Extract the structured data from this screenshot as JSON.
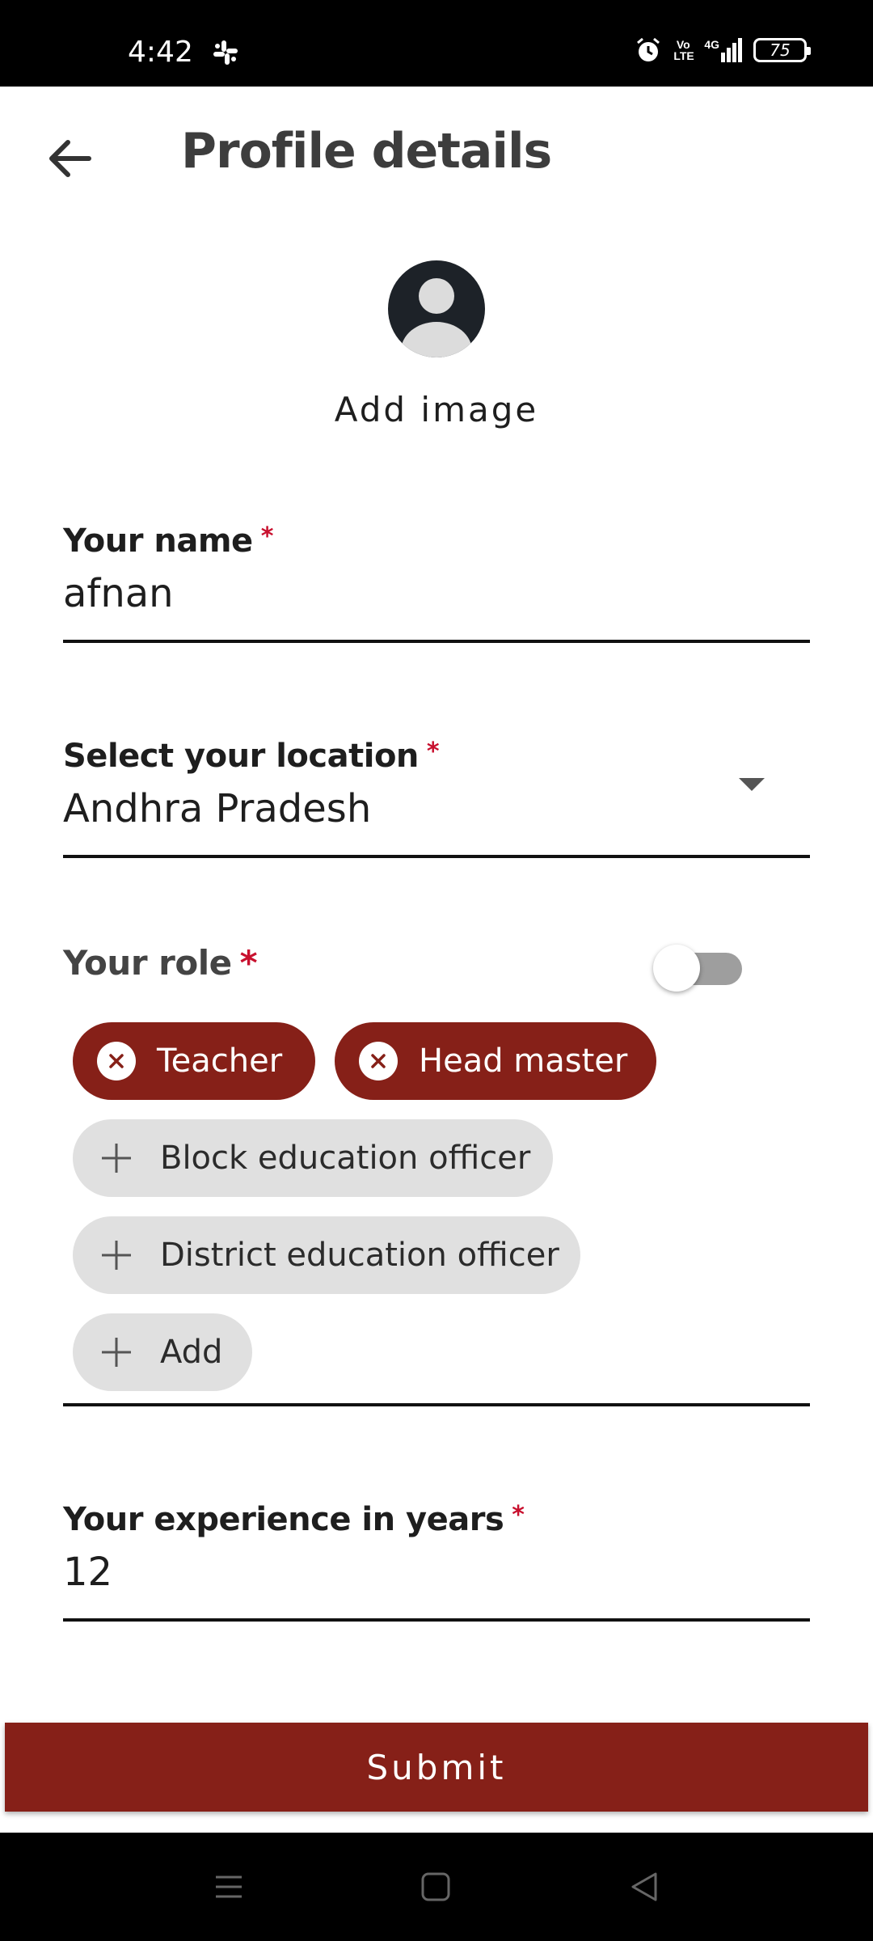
{
  "status_bar": {
    "time": "4:42",
    "volte_label": "Vo\nLTE",
    "network_label": "4G",
    "battery_level": "75"
  },
  "header": {
    "title": "Profile details"
  },
  "avatar": {
    "add_image_label": "Add image"
  },
  "form": {
    "name": {
      "label": "Your name",
      "required_mark": "*",
      "value": "afnan"
    },
    "location": {
      "label": "Select your location",
      "required_mark": "*",
      "value": "Andhra Pradesh"
    },
    "role": {
      "label": "Your role",
      "required_mark": "*",
      "toggle_on": false,
      "selected_chips": [
        "Teacher",
        "Head master"
      ],
      "available_chips": [
        "Block education officer",
        "District education officer"
      ],
      "add_label": "Add"
    },
    "experience": {
      "label": "Your experience in years",
      "required_mark": "*",
      "value": "12"
    }
  },
  "submit_label": "Submit",
  "colors": {
    "accent": "#862018",
    "required": "#c8102e",
    "chip_unselected": "#e0e0e0"
  },
  "icons": [
    "slack-icon",
    "alarm-icon",
    "signal-icon",
    "battery-icon",
    "back-arrow-icon",
    "avatar-icon",
    "dropdown-arrow-icon",
    "close-icon",
    "plus-icon",
    "menu-icon",
    "home-icon",
    "back-icon"
  ]
}
